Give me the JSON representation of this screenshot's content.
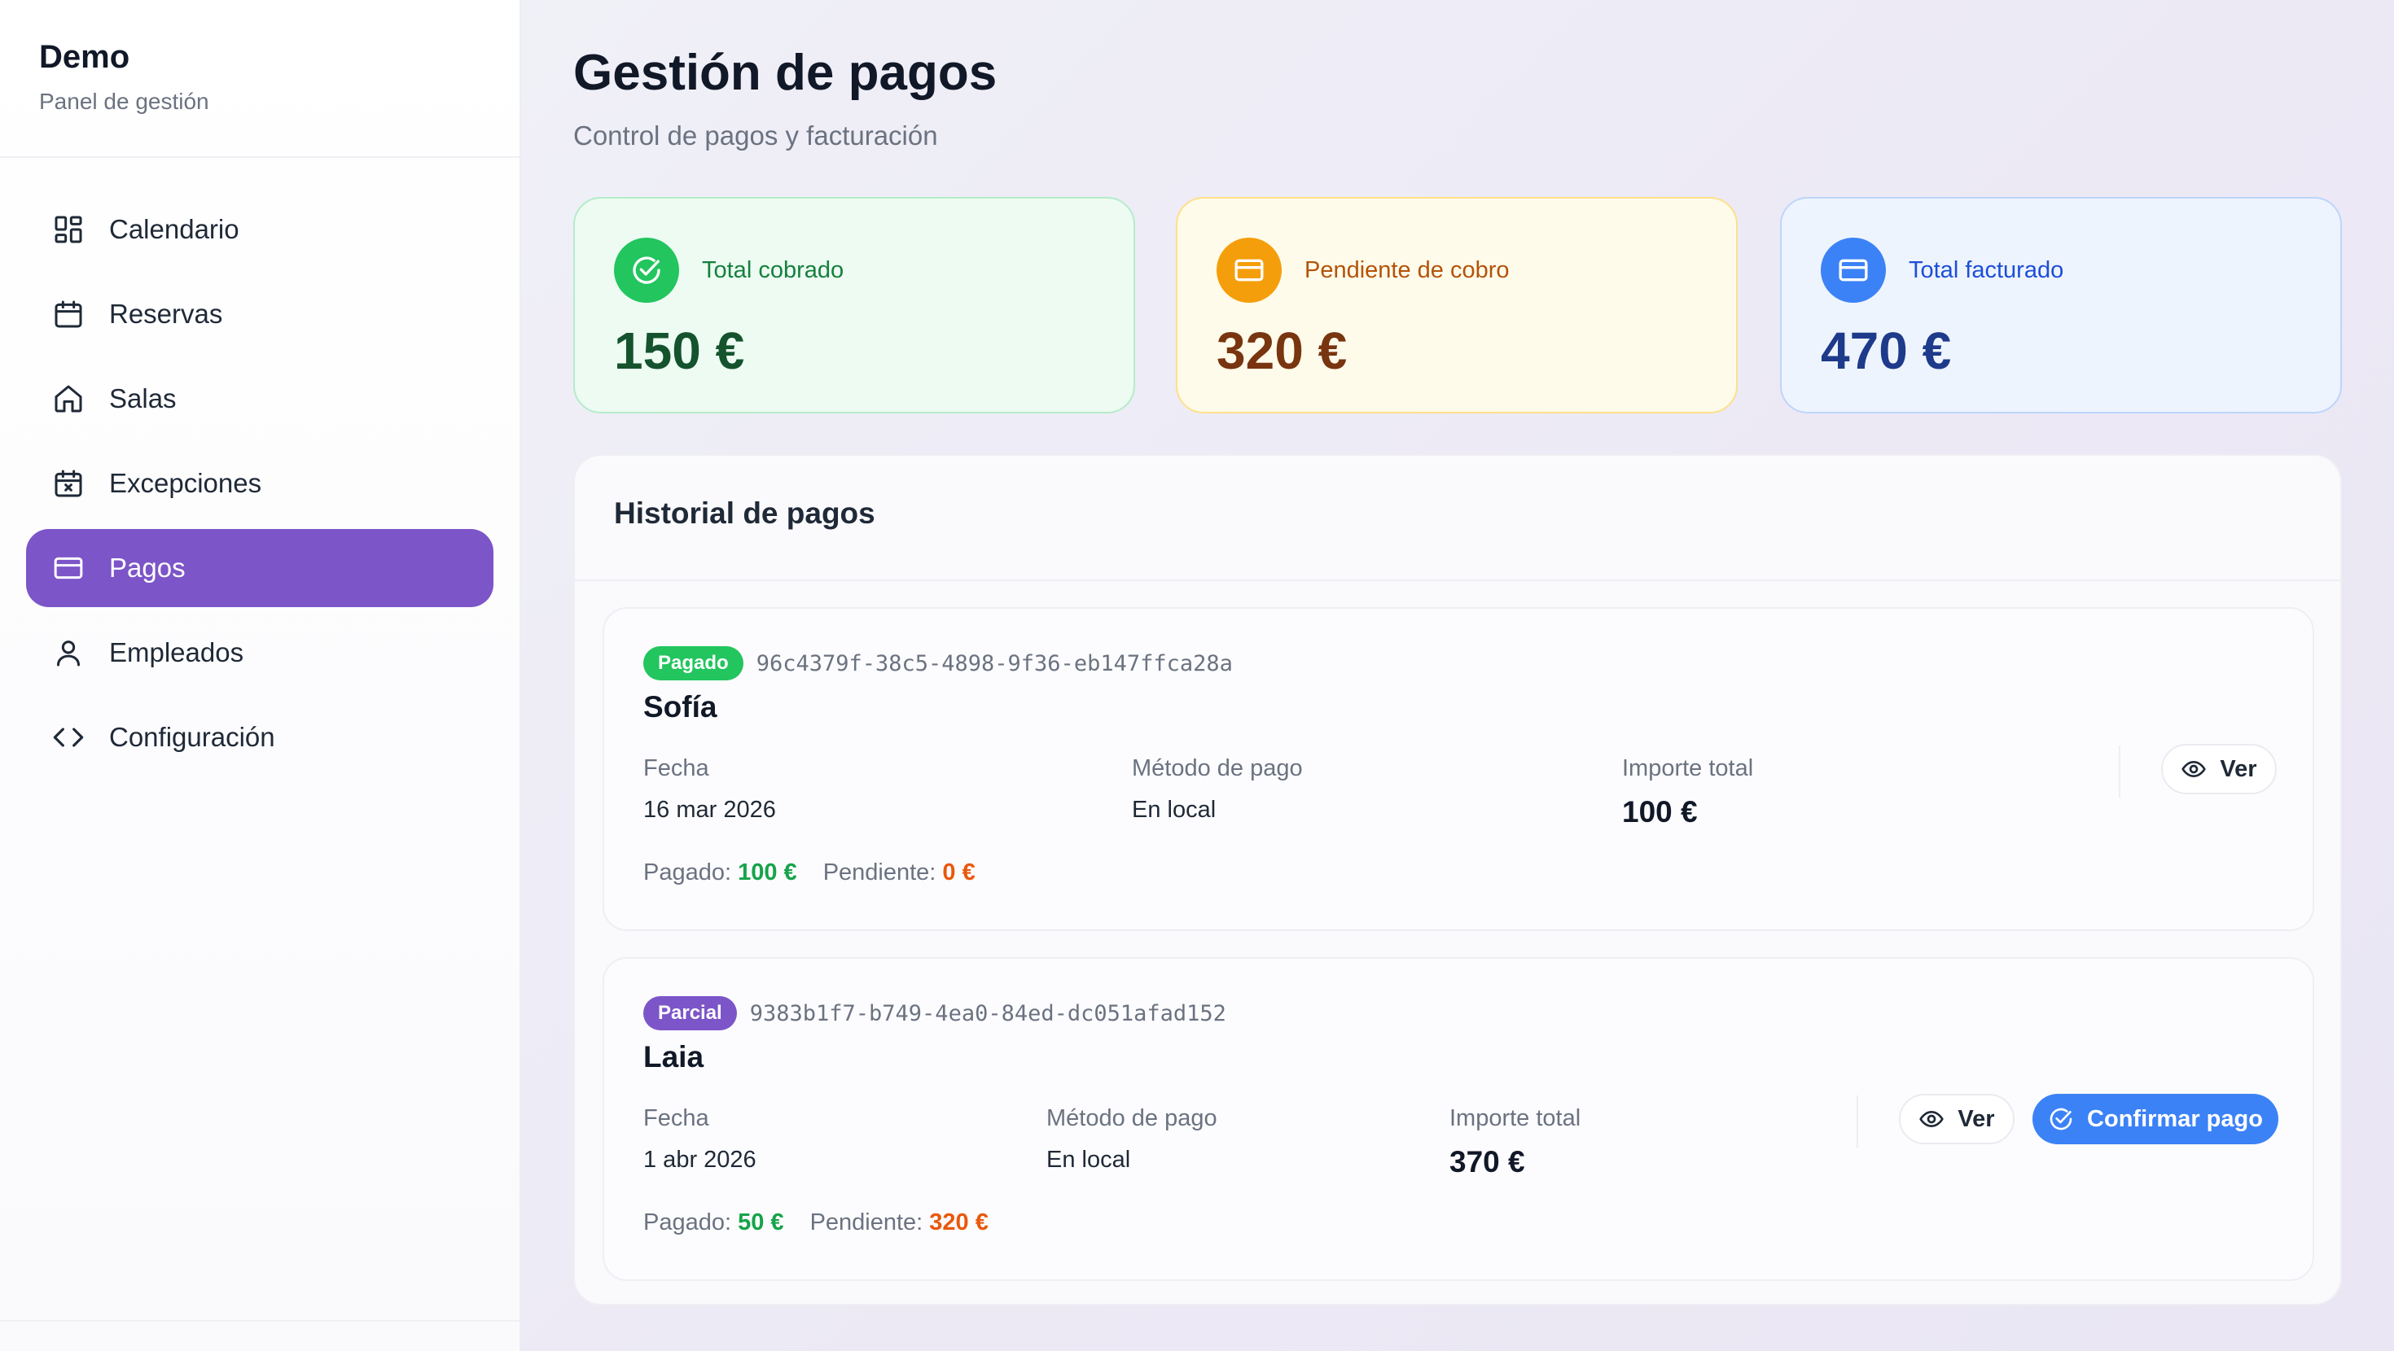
{
  "brand": {
    "title": "Demo",
    "subtitle": "Panel de gestión"
  },
  "nav": [
    {
      "label": "Calendario",
      "icon": "dashboard-icon",
      "active": false
    },
    {
      "label": "Reservas",
      "icon": "calendar-icon",
      "active": false
    },
    {
      "label": "Salas",
      "icon": "home-icon",
      "active": false
    },
    {
      "label": "Excepciones",
      "icon": "calendar-x-icon",
      "active": false
    },
    {
      "label": "Pagos",
      "icon": "credit-card-icon",
      "active": true
    },
    {
      "label": "Empleados",
      "icon": "user-icon",
      "active": false
    },
    {
      "label": "Configuración",
      "icon": "code-icon",
      "active": false
    }
  ],
  "page": {
    "title": "Gestión de pagos",
    "subtitle": "Control de pagos y facturación"
  },
  "stats": {
    "collected": {
      "label": "Total cobrado",
      "value": "150 €",
      "color": "#22c55e"
    },
    "pending": {
      "label": "Pendiente de cobro",
      "value": "320 €",
      "color": "#f59e0b"
    },
    "billed": {
      "label": "Total facturado",
      "value": "470 €",
      "color": "#3b82f6"
    }
  },
  "history": {
    "title": "Historial de pagos",
    "payments": [
      {
        "status": "Pagado",
        "id": "96c4379f-38c5-4898-9f36-eb147ffca28a",
        "name": "Sofía",
        "date_label": "Fecha",
        "date": "16 mar 2026",
        "method_label": "Método de pago",
        "method": "En local",
        "total_label": "Importe total",
        "total": "100 €",
        "paid_label": "Pagado:",
        "paid": "100 €",
        "pending_label": "Pendiente:",
        "pending": "0 €",
        "view_label": "Ver"
      },
      {
        "status": "Parcial",
        "id": "9383b1f7-b749-4ea0-84ed-dc051afad152",
        "name": "Laia",
        "date_label": "Fecha",
        "date": "1 abr 2026",
        "method_label": "Método de pago",
        "method": "En local",
        "total_label": "Importe total",
        "total": "370 €",
        "paid_label": "Pagado:",
        "paid": "50 €",
        "pending_label": "Pendiente:",
        "pending": "320 €",
        "view_label": "Ver",
        "confirm_label": "Confirmar pago"
      }
    ]
  },
  "colors": {
    "accent": "#7c55c8",
    "paid": "#22c55e",
    "partial": "#7c55c8",
    "primary": "#3b82f6"
  }
}
